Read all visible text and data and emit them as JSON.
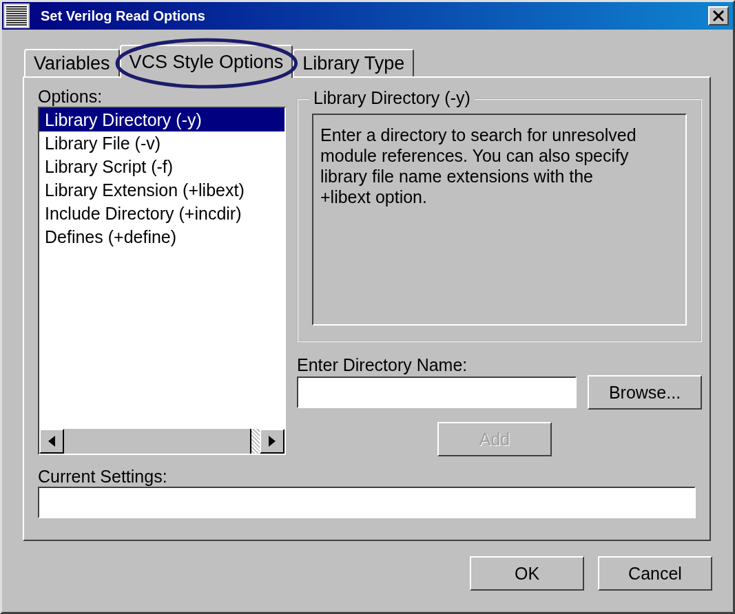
{
  "window": {
    "title": "Set Verilog Read Options"
  },
  "tabs": [
    {
      "label": "Variables",
      "selected": false,
      "circled": false
    },
    {
      "label": "VCS Style Options",
      "selected": true,
      "circled": true
    },
    {
      "label": "Library Type",
      "selected": false,
      "circled": false
    }
  ],
  "options": {
    "label": "Options:",
    "items": [
      {
        "label": "Library Directory (-y)",
        "selected": true
      },
      {
        "label": "Library File (-v)",
        "selected": false
      },
      {
        "label": "Library Script (-f)",
        "selected": false
      },
      {
        "label": "Library Extension (+libext)",
        "selected": false
      },
      {
        "label": "Include Directory (+incdir)",
        "selected": false
      },
      {
        "label": "Defines (+define)",
        "selected": false
      }
    ]
  },
  "group": {
    "title": "Library Directory (-y)",
    "description": "Enter a directory to search for unresolved module references. You can also specify library file name extensions with the +libext option."
  },
  "directory": {
    "label": "Enter Directory Name:",
    "browse": "Browse...",
    "add": {
      "label": "Add",
      "disabled": true
    }
  },
  "current_settings": {
    "label": "Current Settings:"
  },
  "buttons": [
    "OK",
    "Cancel"
  ]
}
